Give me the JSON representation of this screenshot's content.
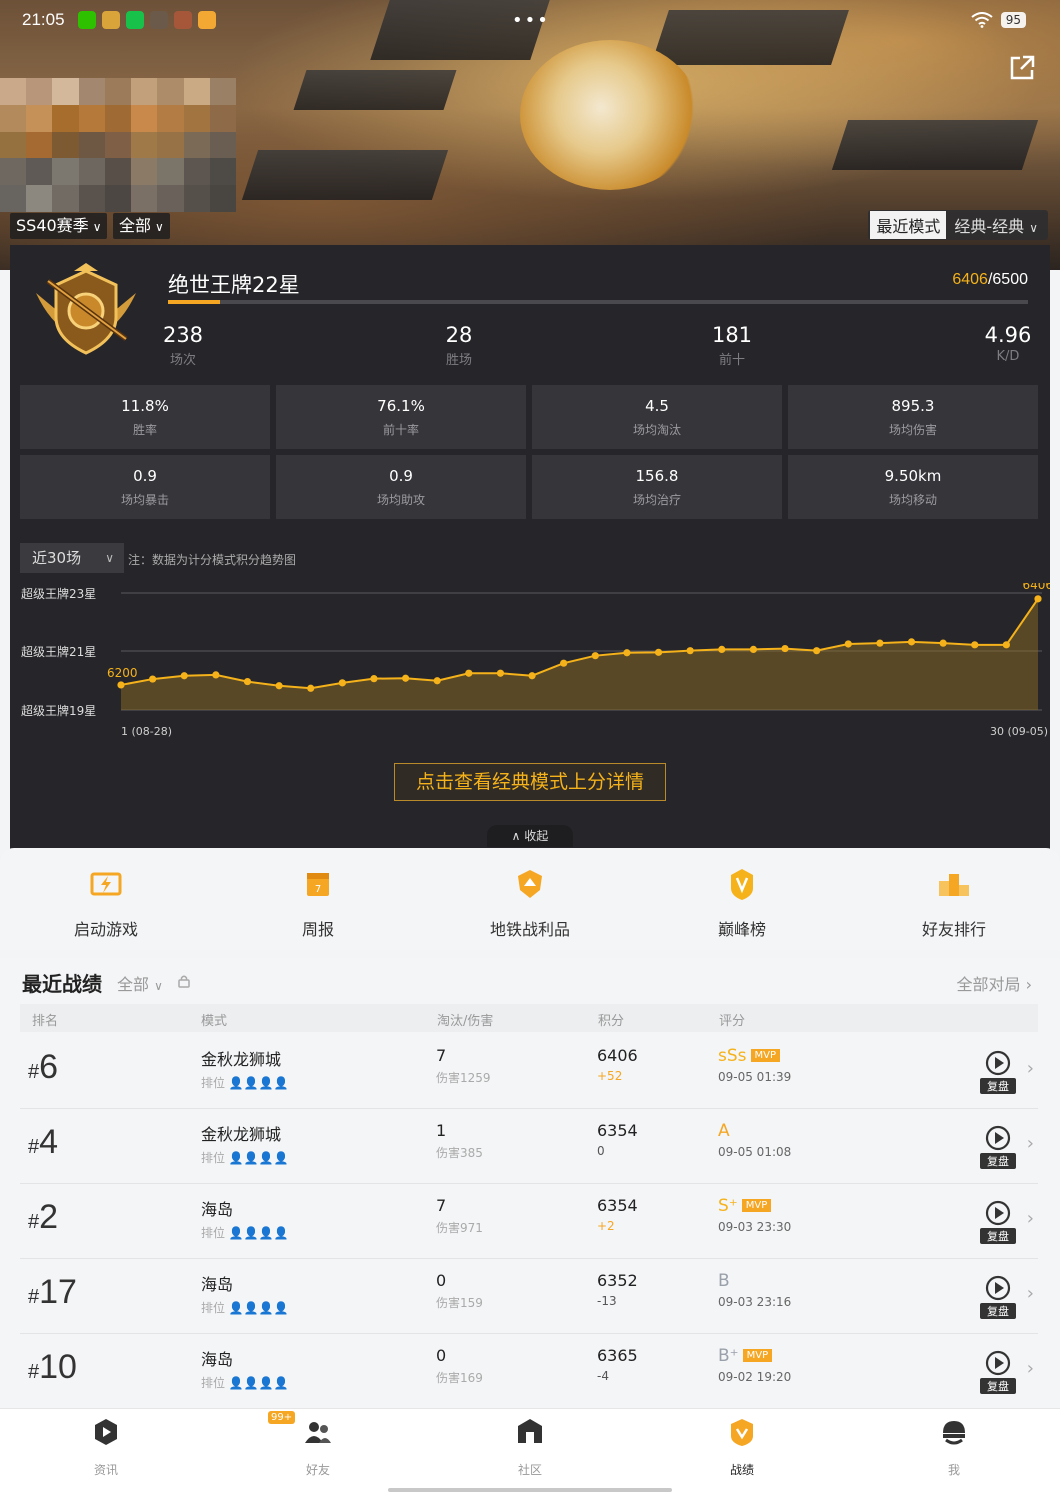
{
  "status": {
    "time": "21:05",
    "battery": "95",
    "menu_dots": "•••"
  },
  "filters": {
    "season": "SS40赛季",
    "scope": "全部",
    "mode_active": "最近模式",
    "mode_inactive": "经典-经典"
  },
  "profile": {
    "rank_title": "绝世王牌22星",
    "points_current": "6406",
    "points_total": "/6500",
    "progress": 0.06
  },
  "main_stats": [
    {
      "value": "238",
      "label": "场次"
    },
    {
      "value": "28",
      "label": "胜场"
    },
    {
      "value": "181",
      "label": "前十"
    },
    {
      "value": "4.96",
      "label": "K/D"
    }
  ],
  "detail_stats": [
    {
      "value": "11.8%",
      "label": "胜率"
    },
    {
      "value": "76.1%",
      "label": "前十率"
    },
    {
      "value": "4.5",
      "label": "场均淘汰"
    },
    {
      "value": "895.3",
      "label": "场均伤害"
    },
    {
      "value": "0.9",
      "label": "场均暴击"
    },
    {
      "value": "0.9",
      "label": "场均助攻"
    },
    {
      "value": "156.8",
      "label": "场均治疗"
    },
    {
      "value": "9.50km",
      "label": "场均移动"
    }
  ],
  "trend": {
    "range": "近30场",
    "note": "注：数据为计分模式积分趋势图"
  },
  "chart_data": {
    "type": "area",
    "y_labels": [
      "超级王牌23星",
      "超级王牌21星",
      "超级王牌19星"
    ],
    "x_start_label": "1 (08-28)",
    "x_end_label": "30 (09-05)",
    "start_value_label": "6200",
    "end_value_label": "6406",
    "x": [
      1,
      2,
      3,
      4,
      5,
      6,
      7,
      8,
      9,
      10,
      11,
      12,
      13,
      14,
      15,
      16,
      17,
      18,
      19,
      20,
      21,
      22,
      23,
      24,
      25,
      26,
      27,
      28,
      29,
      30
    ],
    "values": [
      6200,
      6214,
      6222,
      6224,
      6208,
      6198,
      6192,
      6205,
      6215,
      6216,
      6210,
      6228,
      6228,
      6222,
      6252,
      6270,
      6277,
      6278,
      6282,
      6285,
      6285,
      6287,
      6282,
      6298,
      6300,
      6303,
      6300,
      6296,
      6296,
      6296
    ],
    "final_value": 6406,
    "ylim": [
      6140,
      6420
    ],
    "color": "#f5b21a"
  },
  "detail_button": "点击查看经典模式上分详情",
  "collapse_label": "收起",
  "quick_entries": [
    {
      "label": "启动游戏",
      "icon": "launch-game-icon"
    },
    {
      "label": "周报",
      "icon": "calendar-icon"
    },
    {
      "label": "地铁战利品",
      "icon": "metro-loot-icon"
    },
    {
      "label": "巅峰榜",
      "icon": "peak-rank-icon"
    },
    {
      "label": "好友排行",
      "icon": "podium-icon"
    }
  ],
  "records": {
    "title": "最近战绩",
    "filter": "全部",
    "all_link": "全部对局",
    "headers": [
      "排名",
      "模式",
      "淘汰/伤害",
      "积分",
      "评分"
    ],
    "rows": [
      {
        "rank": "6",
        "map": "金秋龙狮城",
        "sub": "排位",
        "kills": "7",
        "damage": "伤害1259",
        "score": "6406",
        "delta": "+52",
        "delta_color": "#f5a623",
        "grade": "sSs",
        "grade_color": "#f5b21a",
        "mvp": "MVP",
        "time": "09-05 01:39"
      },
      {
        "rank": "4",
        "map": "金秋龙狮城",
        "sub": "排位",
        "kills": "1",
        "damage": "伤害385",
        "score": "6354",
        "delta": "0",
        "delta_color": "#555555",
        "grade": "A",
        "grade_color": "#f5a623",
        "mvp": "",
        "time": "09-05 01:08"
      },
      {
        "rank": "2",
        "map": "海岛",
        "sub": "排位",
        "kills": "7",
        "damage": "伤害971",
        "score": "6354",
        "delta": "+2",
        "delta_color": "#f5a623",
        "grade": "S⁺",
        "grade_color": "#f5b21a",
        "mvp": "MVP",
        "time": "09-03 23:30"
      },
      {
        "rank": "17",
        "map": "海岛",
        "sub": "排位",
        "kills": "0",
        "damage": "伤害159",
        "score": "6352",
        "delta": "-13",
        "delta_color": "#555555",
        "grade": "B",
        "grade_color": "#9aa0aa",
        "mvp": "",
        "time": "09-03 23:16"
      },
      {
        "rank": "10",
        "map": "海岛",
        "sub": "排位",
        "kills": "0",
        "damage": "伤害169",
        "score": "6365",
        "delta": "-4",
        "delta_color": "#555555",
        "grade": "B⁺",
        "grade_color": "#9aa0aa",
        "mvp": "MVP",
        "time": "09-02 19:20"
      }
    ],
    "replay_label": "复盘"
  },
  "nav": [
    {
      "label": "资讯",
      "icon": "news-icon",
      "active": false
    },
    {
      "label": "好友",
      "icon": "friends-icon",
      "active": false,
      "badge": "99+"
    },
    {
      "label": "社区",
      "icon": "community-icon",
      "active": false
    },
    {
      "label": "战绩",
      "icon": "record-icon",
      "active": true
    },
    {
      "label": "我",
      "icon": "profile-icon",
      "active": false
    }
  ]
}
